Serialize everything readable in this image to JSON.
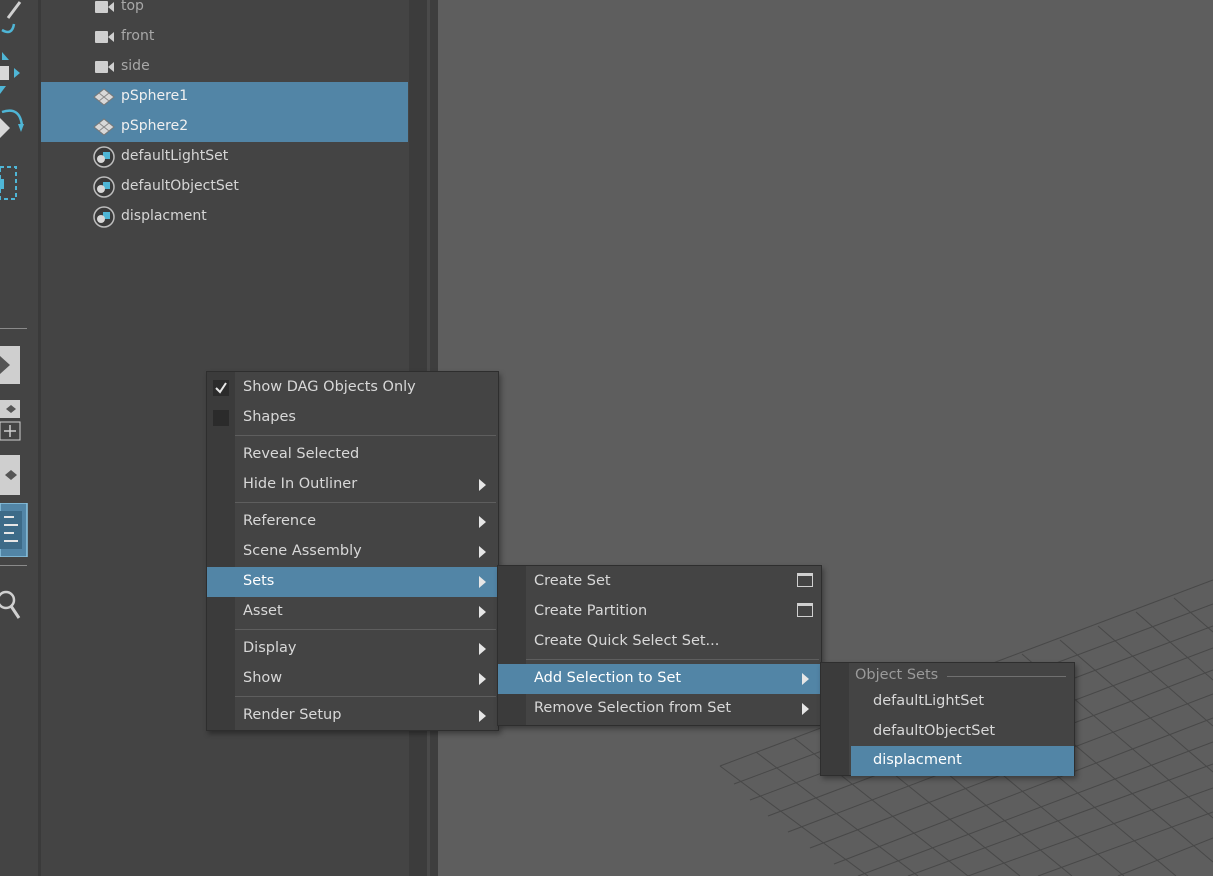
{
  "outliner": {
    "items": [
      {
        "label": "top",
        "type": "camera",
        "selected": false
      },
      {
        "label": "front",
        "type": "camera",
        "selected": false
      },
      {
        "label": "side",
        "type": "camera",
        "selected": false
      },
      {
        "label": "pSphere1",
        "type": "mesh",
        "selected": true
      },
      {
        "label": "pSphere2",
        "type": "mesh",
        "selected": true
      },
      {
        "label": "defaultLightSet",
        "type": "set",
        "selected": false
      },
      {
        "label": "defaultObjectSet",
        "type": "set",
        "selected": false
      },
      {
        "label": "displacment",
        "type": "set",
        "selected": false
      }
    ]
  },
  "context_menu": {
    "show_dag_objects_only": "Show DAG Objects Only",
    "shapes": "Shapes",
    "reveal_selected": "Reveal Selected",
    "hide_in_outliner": "Hide In Outliner",
    "reference": "Reference",
    "scene_assembly": "Scene Assembly",
    "sets": "Sets",
    "asset": "Asset",
    "display": "Display",
    "show": "Show",
    "render_setup": "Render Setup",
    "show_dag_checked": true,
    "shapes_checked": false
  },
  "sets_submenu": {
    "create_set": "Create Set",
    "create_partition": "Create Partition",
    "create_quick_select_set": "Create Quick Select Set...",
    "add_selection_to_set": "Add Selection to Set",
    "remove_selection_from_set": "Remove Selection from Set"
  },
  "object_sets_submenu": {
    "section_title": "Object Sets",
    "items": [
      "defaultLightSet",
      "defaultObjectSet",
      "displacment"
    ],
    "highlighted": "displacment"
  },
  "colors": {
    "selection": "#5285a6",
    "panel": "#444444",
    "viewport": "#5e5e5e",
    "tool_accent": "#4fb6d6"
  },
  "icons": {
    "camera": "camera-icon",
    "mesh": "mesh-icon",
    "set": "object-set-icon"
  }
}
